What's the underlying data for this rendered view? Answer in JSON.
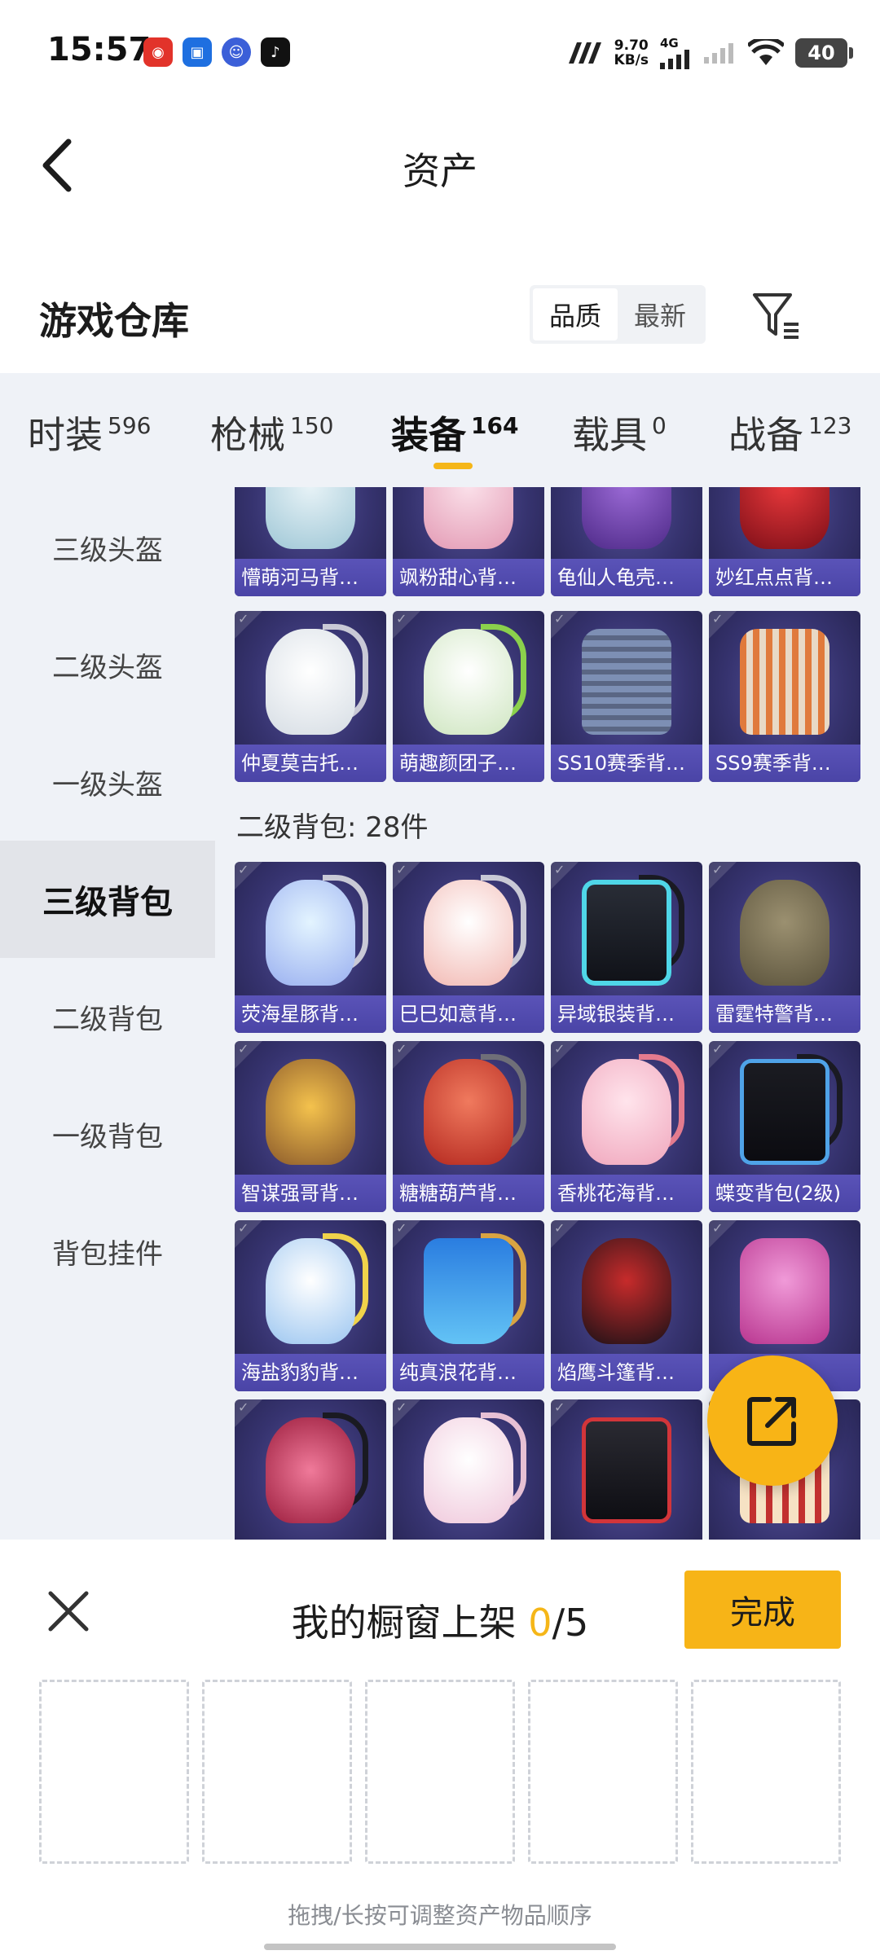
{
  "status_bar": {
    "time": "15:57",
    "speed_value": "9.70",
    "speed_unit": "KB/s",
    "network": "4G",
    "battery": "40",
    "icons": [
      "netease-music-icon",
      "camera-app-icon",
      "mascot-app-icon",
      "tiktok-icon",
      "carrier-icon",
      "signal-icon",
      "signal-weak-icon",
      "wifi-icon",
      "battery-icon"
    ]
  },
  "header": {
    "title": "资产"
  },
  "warehouse": {
    "title": "游戏仓库",
    "sort_options": [
      "品质",
      "最新"
    ],
    "sort_selected": "品质"
  },
  "tabs": [
    {
      "label": "时装",
      "count": "596"
    },
    {
      "label": "枪械",
      "count": "150"
    },
    {
      "label": "装备",
      "count": "164",
      "active": true
    },
    {
      "label": "载具",
      "count": "0"
    },
    {
      "label": "战备",
      "count": "123"
    }
  ],
  "side_nav": [
    "三级头盔",
    "二级头盔",
    "一级头盔",
    "三级背包",
    "二级背包",
    "一级背包",
    "背包挂件"
  ],
  "side_nav_active": "三级背包",
  "top_items": [
    "懵萌河马背…",
    "飒粉甜心背…",
    "龟仙人龟壳…",
    "妙红点点背…",
    "仲夏莫吉托…",
    "萌趣颜团子…",
    "SS10赛季背…",
    "SS9赛季背…"
  ],
  "group": {
    "header": "二级背包: 28件",
    "items": [
      "荧海星豚背…",
      "巳巳如意背…",
      "异域银装背…",
      "雷霆特警背…",
      "智谋强哥背…",
      "糖糖葫芦背…",
      "香桃花海背…",
      "蝶变背包(2级)",
      "海盐豹豹背…",
      "纯真浪花背…",
      "焰鹰斗篷背…",
      ""
    ]
  },
  "sheet": {
    "title_prefix": "我的橱窗上架 ",
    "count": "0",
    "total": "/5",
    "done_label": "完成",
    "hint": "拖拽/长按可调整资产物品顺序",
    "slots": 5
  },
  "colors": {
    "accent": "#f5b618",
    "card_bg": "#36336f",
    "card_label": "#4a44a6",
    "panel_bg": "#eff2f7"
  }
}
